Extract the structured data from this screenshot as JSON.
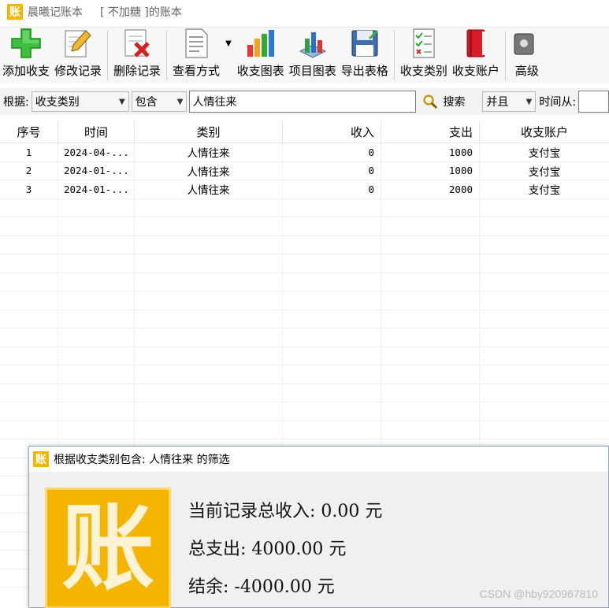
{
  "window": {
    "app_title": "晨曦记账本",
    "book_title": "[ 不加糖 ]的账本",
    "logo_char": "账"
  },
  "toolbar": {
    "buttons": [
      {
        "label": "添加收支",
        "icon": "plus-icon"
      },
      {
        "label": "修改记录",
        "icon": "edit-icon"
      },
      {
        "label": "删除记录",
        "icon": "delete-icon"
      },
      {
        "label": "查看方式",
        "icon": "document-icon"
      },
      {
        "label": "收支图表",
        "icon": "bar-chart-icon"
      },
      {
        "label": "项目图表",
        "icon": "3d-chart-icon"
      },
      {
        "label": "导出表格",
        "icon": "save-disk-icon"
      },
      {
        "label": "收支类别",
        "icon": "checklist-icon"
      },
      {
        "label": "收支账户",
        "icon": "book-icon"
      },
      {
        "label": "高级",
        "icon": "advanced-icon"
      }
    ]
  },
  "filter": {
    "basis_label": "根据:",
    "field": "收支类别",
    "operator": "包含",
    "keyword": "人情往来",
    "search_label": "搜索",
    "logic": "并且",
    "time_from_label": "时间从:"
  },
  "table": {
    "headers": [
      "序号",
      "时间",
      "类别",
      "收入",
      "支出",
      "收支账户"
    ],
    "rows": [
      [
        "1",
        "2024-04-...",
        "人情往来",
        "0",
        "1000",
        "支付宝"
      ],
      [
        "2",
        "2024-01-...",
        "人情往来",
        "0",
        "1000",
        "支付宝"
      ],
      [
        "3",
        "2024-01-...",
        "人情往来",
        "0",
        "2000",
        "支付宝"
      ]
    ]
  },
  "dialog": {
    "title": "根据收支类别包含: 人情往来 的筛选",
    "logo_char": "账",
    "total_income": "当前记录总收入: 0.00 元",
    "total_expense": "总支出: 4000.00 元",
    "balance": "结余: -4000.00 元"
  },
  "watermark": "CSDN @hby920967810",
  "colors": {
    "brand": "#f5b400",
    "toolbar_bg": "#f7f7f7",
    "grid_line": "#efefef"
  }
}
